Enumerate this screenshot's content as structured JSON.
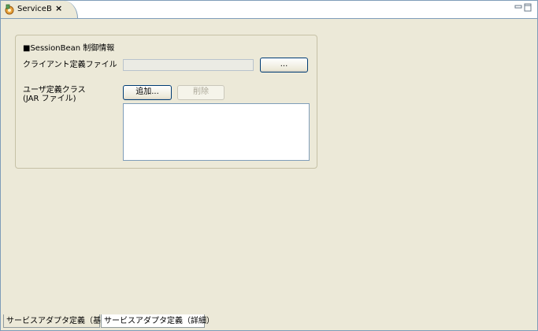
{
  "editor_tab": {
    "title": "ServiceB",
    "close_label": "×"
  },
  "group": {
    "title": "■SessionBean 制御情報",
    "client_file_label": "クライアント定義ファイル",
    "client_file_value": "",
    "browse_button_label": "...",
    "user_class_label_line1": "ユーザ定義クラス",
    "user_class_label_line2": "(JAR ファイル)",
    "add_button_label": "追加...",
    "delete_button_label": "削除",
    "jar_list_items": []
  },
  "bottom_tabs": [
    {
      "label": "サービスアダプタ定義（基本）",
      "active": false
    },
    {
      "label": "サービスアダプタ定義（詳細）",
      "active": true
    }
  ]
}
